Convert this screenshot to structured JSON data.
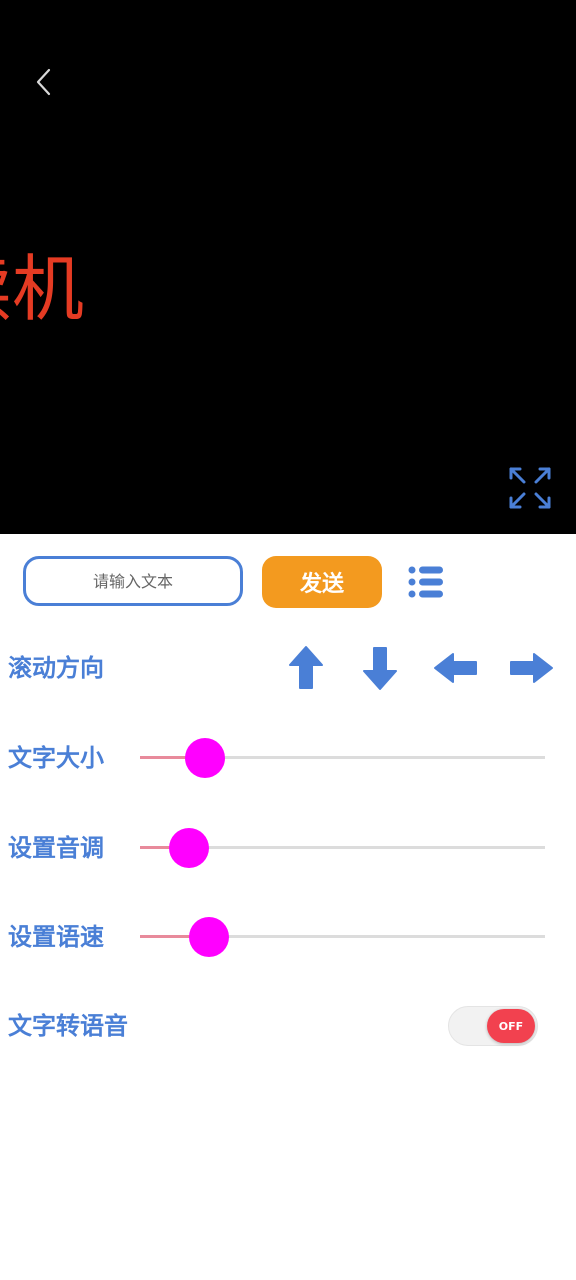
{
  "display": {
    "marquee_text": "读机",
    "text_color": "#e53b23",
    "background": "#000000"
  },
  "icons": {
    "back": "back-chevron-icon",
    "fullscreen": "expand-arrows-icon",
    "list": "list-icon"
  },
  "input": {
    "placeholder": "请输入文本",
    "value": ""
  },
  "send_button": {
    "label": "发送",
    "color": "#f39a1f"
  },
  "scroll_direction": {
    "label": "滚动方向",
    "directions": [
      "up",
      "down",
      "left",
      "right"
    ]
  },
  "text_size": {
    "label": "文字大小",
    "value_fraction": 0.16
  },
  "pitch": {
    "label": "设置音调",
    "value_fraction": 0.12
  },
  "speech_rate": {
    "label": "设置语速",
    "value_fraction": 0.17
  },
  "text_to_speech": {
    "label": "文字转语音",
    "state": "OFF"
  },
  "colors": {
    "accent": "#4a7fd6",
    "slider_thumb": "#ff00ff",
    "slider_fill": "#e88a9b",
    "toggle_off": "#f2414f"
  }
}
